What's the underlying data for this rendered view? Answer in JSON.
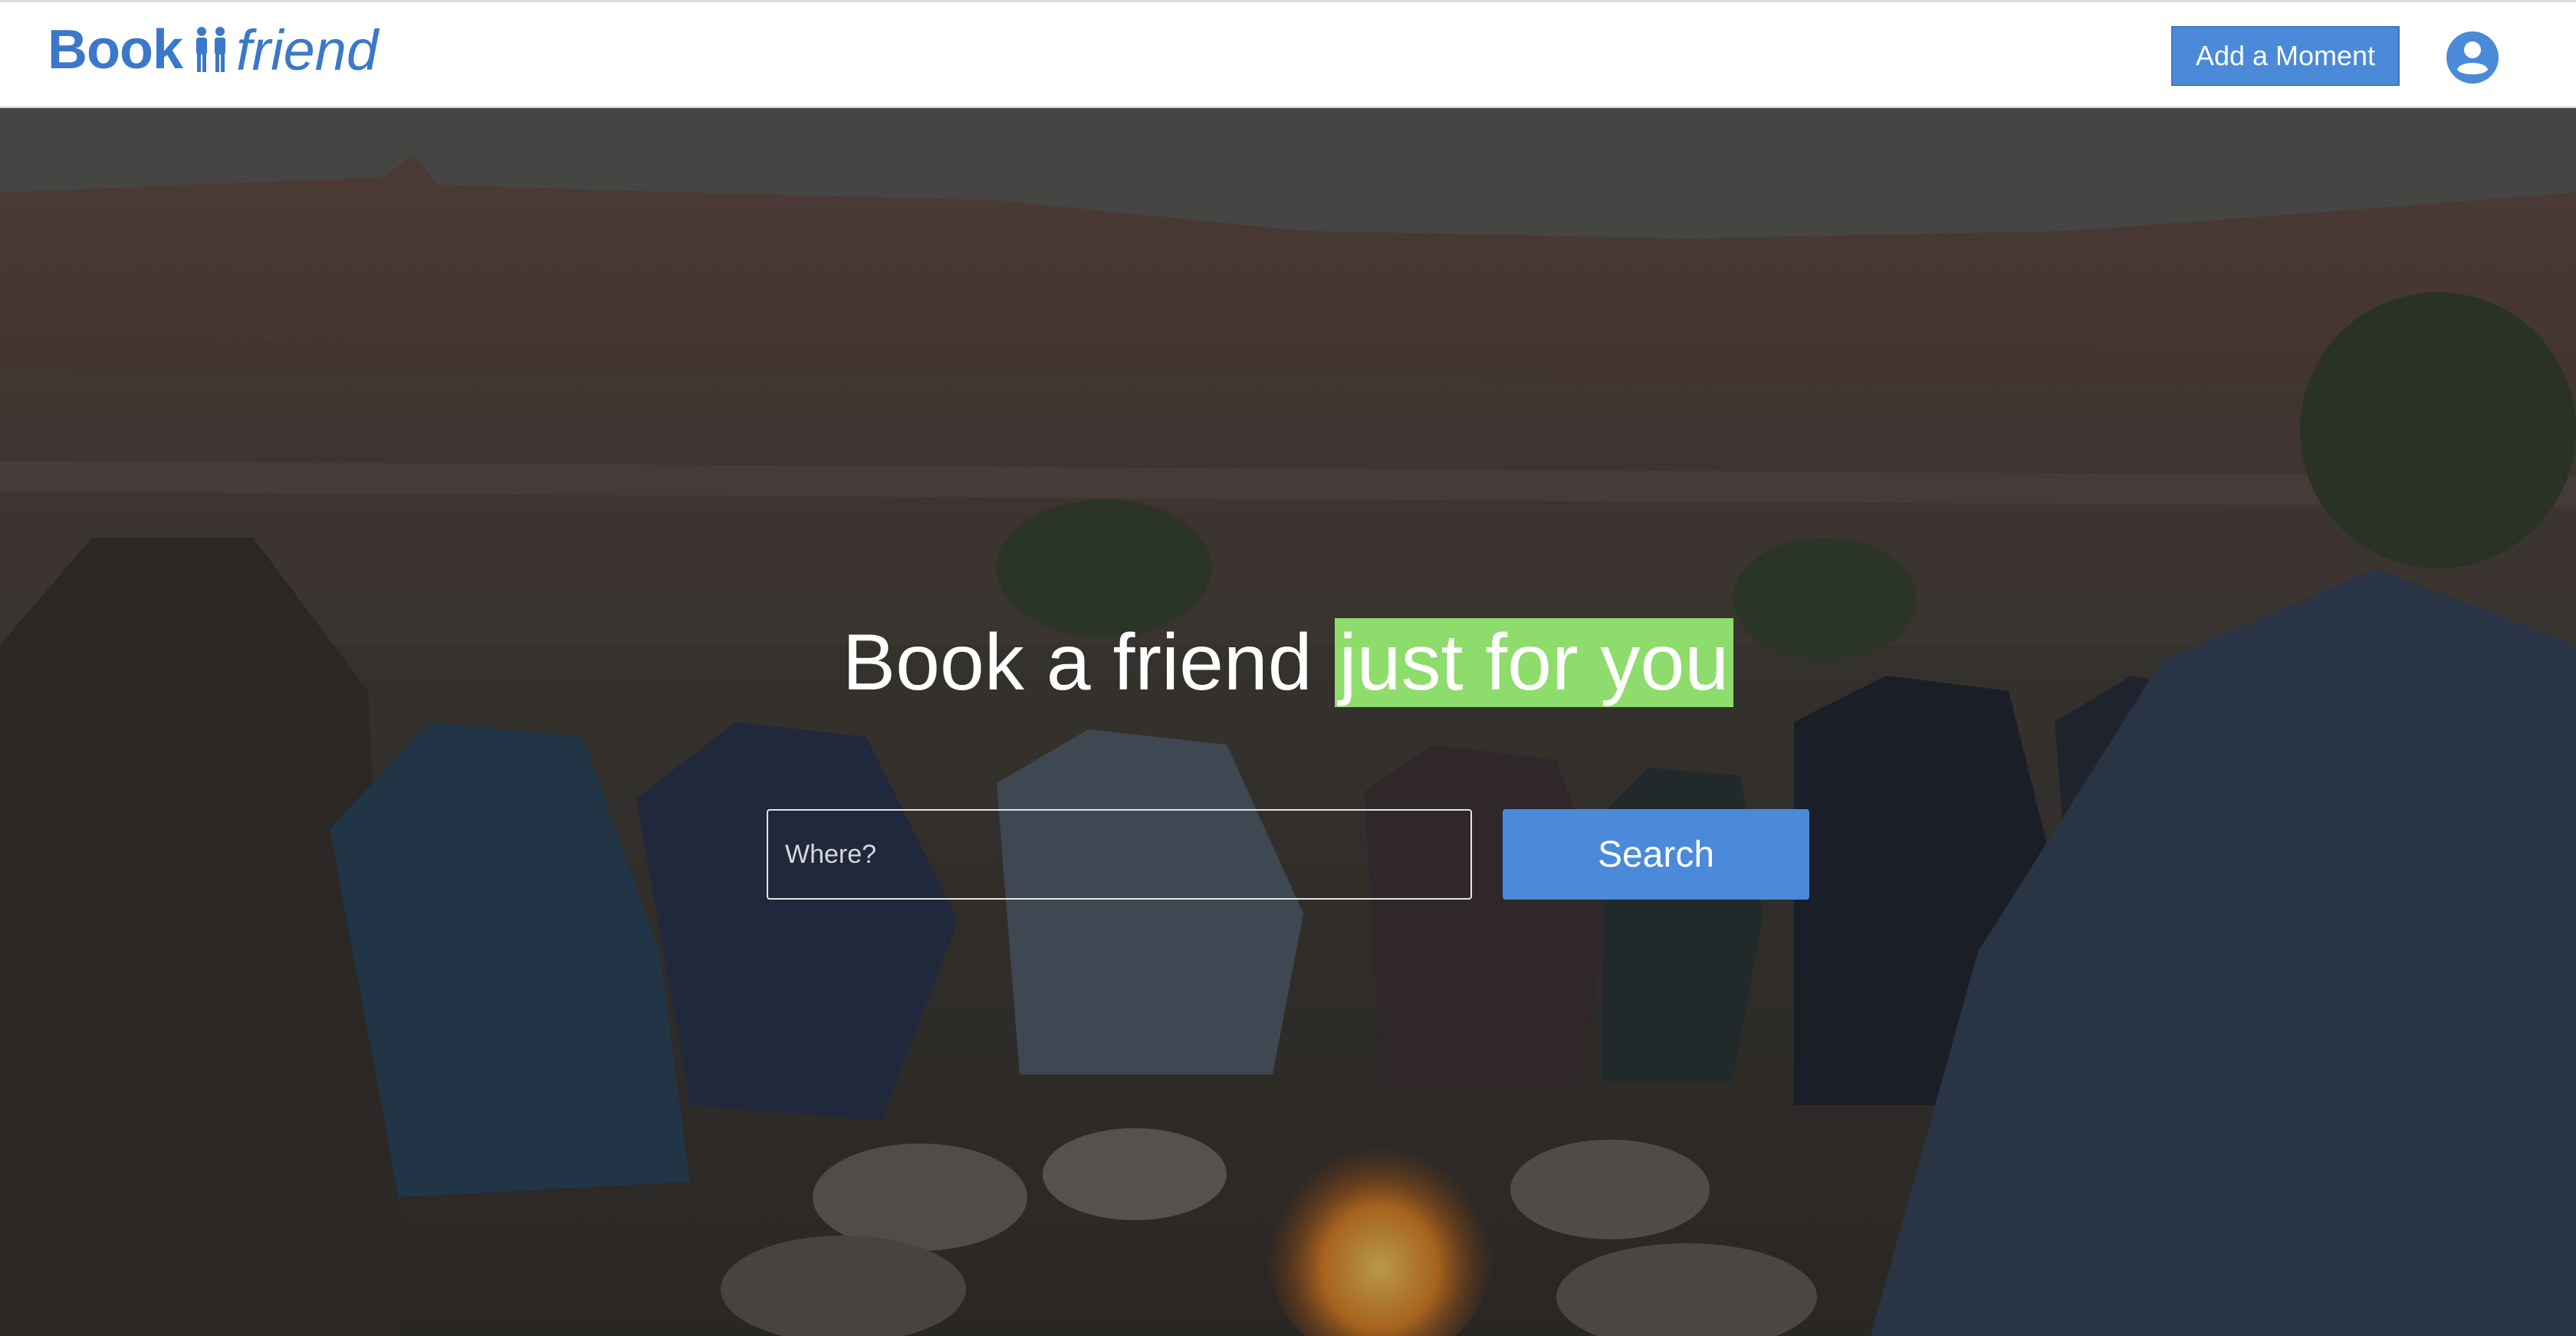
{
  "brand": {
    "name_bold": "Book",
    "name_italic": "friend",
    "color": "#3b78c9"
  },
  "header": {
    "add_moment_label": "Add a Moment",
    "add_moment_color": "#4a8ad8",
    "avatar_icon": "user-circle-icon"
  },
  "hero": {
    "headline_prefix": "Book a friend ",
    "headline_highlight": "just for you",
    "highlight_color": "#8edc6c",
    "background_image": "friends-around-campfire-photo",
    "search": {
      "placeholder": "Where?",
      "value": "",
      "button_label": "Search",
      "button_color": "#4a8ad8"
    }
  }
}
